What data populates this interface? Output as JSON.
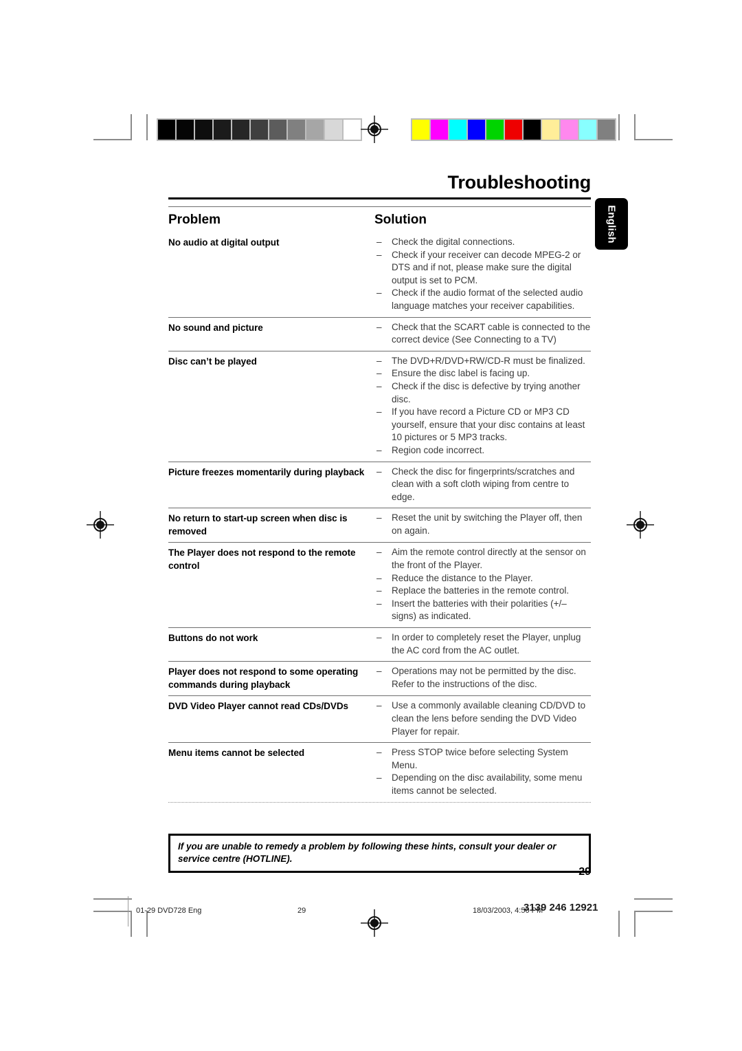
{
  "document": {
    "title": "Troubleshooting",
    "page_number": "29",
    "language_tab": "English"
  },
  "table": {
    "headers": {
      "problem": "Problem",
      "solution": "Solution"
    },
    "rows": [
      {
        "problem": "No audio at digital output",
        "solutions": [
          "Check the digital connections.",
          "Check if your receiver can decode MPEG-2 or DTS and if not, please make sure the digital output is set to PCM.",
          "Check if the audio format of the selected audio language matches your receiver capabilities."
        ]
      },
      {
        "problem": "No sound and picture",
        "solutions": [
          "Check that the SCART cable is connected to the correct device (See Connecting to a TV)"
        ]
      },
      {
        "problem": "Disc can’t be played",
        "solutions": [
          "The DVD+R/DVD+RW/CD-R must be finalized.",
          "Ensure the disc label is facing up.",
          "Check if the disc is defective by trying another disc.",
          "If you have record a Picture CD or MP3 CD yourself, ensure that your disc contains at least 10 pictures or 5 MP3 tracks.",
          "Region code incorrect."
        ]
      },
      {
        "problem": "Picture freezes momentarily during playback",
        "solutions": [
          "Check the disc for fingerprints/scratches and clean with a soft cloth wiping from centre to edge."
        ]
      },
      {
        "problem": "No return to start-up screen when disc is removed",
        "solutions": [
          "Reset the unit by switching the Player off, then on again."
        ]
      },
      {
        "problem": "The Player does not respond to the remote control",
        "solutions": [
          "Aim the remote control directly at the sensor on the front of the Player.",
          "Reduce the distance to the Player.",
          "Replace the batteries in the remote control.",
          "Insert the batteries with their polarities (+/– signs) as indicated."
        ]
      },
      {
        "problem": "Buttons do not work",
        "solutions": [
          "In order to completely reset the Player, unplug the AC cord from the AC outlet."
        ]
      },
      {
        "problem": "Player does not respond to some operating commands during playback",
        "solutions": [
          "Operations may not be permitted by the disc. Refer to the instructions of  the disc."
        ]
      },
      {
        "problem": "DVD Video Player cannot read CDs/DVDs",
        "solutions": [
          "Use a commonly available cleaning CD/DVD to clean the lens before sending the DVD Video Player for repair."
        ]
      },
      {
        "problem": "Menu items cannot be selected",
        "solutions": [
          "Press STOP twice before selecting System Menu.",
          "Depending on the disc availability, some menu items cannot be selected."
        ]
      }
    ],
    "list_marker": "–"
  },
  "hotline_note": "If you are unable to remedy a problem by following these hints, consult your dealer or service centre (HOTLINE).",
  "imposition_footer": {
    "file": "01-29 DVD728 Eng",
    "page": "29",
    "date": "18/03/2003, 4:50 PM",
    "code": "3139 246 12921"
  },
  "calibration": {
    "grayscale": [
      "#000000",
      "#050505",
      "#0e0e0e",
      "#1b1b1b",
      "#262626",
      "#3f3f3f",
      "#5c5c5c",
      "#808080",
      "#a6a6a6",
      "#d8d8d8",
      "#ffffff"
    ],
    "colors": [
      "#ffff00",
      "#ff00ff",
      "#00ffff",
      "#0000ff",
      "#00d400",
      "#ee0000",
      "#000000",
      "#ffee99",
      "#ff88ee",
      "#88ffff",
      "#808080"
    ]
  }
}
